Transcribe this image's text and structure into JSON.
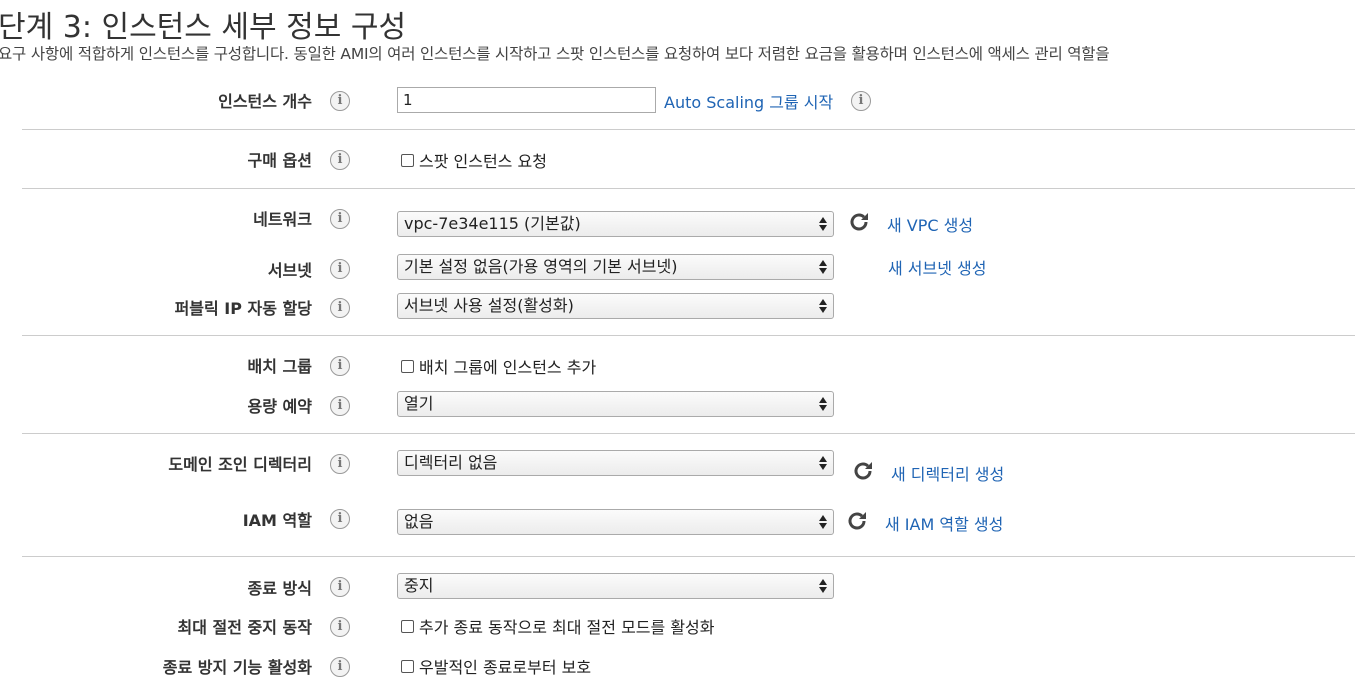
{
  "page": {
    "title": "단계 3: 인스턴스 세부 정보 구성",
    "description": "요구 사항에 적합하게 인스턴스를 구성합니다. 동일한 AMI의 여러 인스턴스를 시작하고 스팟 인스턴스를 요청하여 보다 저렴한 요금을 활용하며 인스턴스에 액세스 관리 역할을"
  },
  "fields": {
    "instance_count": {
      "label": "인스턴스 개수",
      "value": "1",
      "link": "Auto Scaling 그룹 시작"
    },
    "purchase_option": {
      "label": "구매 옵션",
      "checkbox": "스팟 인스턴스 요청"
    },
    "network": {
      "label": "네트워크",
      "value": "vpc-7e34e115 (기본값)",
      "link": "새 VPC 생성"
    },
    "subnet": {
      "label": "서브넷",
      "value": "기본 설정 없음(가용 영역의 기본 서브넷)",
      "link": "새 서브넷 생성"
    },
    "public_ip": {
      "label": "퍼블릭 IP 자동 할당",
      "value": "서브넷 사용 설정(활성화)"
    },
    "placement_group": {
      "label": "배치 그룹",
      "checkbox": "배치 그룹에 인스턴스 추가"
    },
    "capacity_reservation": {
      "label": "용량 예약",
      "value": "열기"
    },
    "domain_join": {
      "label": "도메인 조인 디렉터리",
      "value": "디렉터리 없음",
      "link": "새 디렉터리 생성"
    },
    "iam_role": {
      "label": "IAM 역할",
      "value": "없음",
      "link": "새 IAM 역할 생성"
    },
    "shutdown_behavior": {
      "label": "종료 방식",
      "value": "중지"
    },
    "stop_hibernate": {
      "label": "최대 절전 중지 동작",
      "checkbox": "추가 종료 동작으로 최대 절전 모드를 활성화"
    },
    "termination_protection": {
      "label": "종료 방지 기능 활성화",
      "checkbox": "우발적인 종료로부터 보호"
    }
  },
  "icons": {
    "info": "i"
  },
  "colors": {
    "link": "#1f64b4",
    "divider": "#cccccc"
  }
}
